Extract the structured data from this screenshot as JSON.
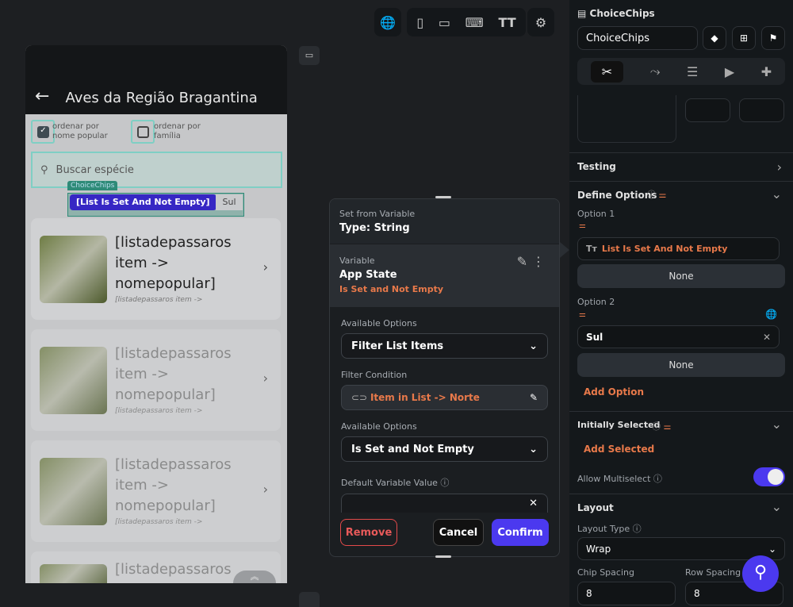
{
  "toolbar": {
    "icons": [
      "globe-icon",
      "phone-icon",
      "tablet-icon",
      "keyboard-icon",
      "text-size-icon",
      "tree-icon"
    ]
  },
  "phone": {
    "title": "Aves da Região Bragantina",
    "check1": "ordenar por nome popular",
    "check2": "ordenar por família",
    "search_placeholder": "Buscar espécie",
    "chip_tag": "ChoiceChips",
    "chip1": "[List Is Set And Not Empty]",
    "chip2": "Sul",
    "items": [
      {
        "title": "[listadepassaros item -> nomepopular]",
        "sub": "[listadepassaros item ->"
      },
      {
        "title": "[listadepassaros item -> nomepopular]",
        "sub": "[listadepassaros item ->"
      },
      {
        "title": "[listadepassaros item -> nomepopular]",
        "sub": "[listadepassaros item ->"
      },
      {
        "title": "[listadepassaros",
        "sub": ""
      }
    ]
  },
  "popup": {
    "header_label": "Set from Variable",
    "header_type": "Type: String",
    "var_label": "Variable",
    "var_source": "App State",
    "var_cond": "Is Set and Not Empty",
    "opt1_label": "Available Options",
    "opt1_value": "Filter List Items",
    "filter_label": "Filter Condition",
    "filter_value": "Item in List -> Norte",
    "opt2_label": "Available Options",
    "opt2_value": "Is Set and Not Empty",
    "default_label": "Default Variable Value",
    "remove": "Remove",
    "cancel": "Cancel",
    "confirm": "Confirm"
  },
  "panel": {
    "widget_type": "ChoiceChips",
    "widget_name": "ChoiceChips",
    "testing": "Testing",
    "define_options": "Define Options",
    "option1_label": "Option 1",
    "option1_value": "List Is Set And Not Empty",
    "none1": "None",
    "option2_label": "Option 2",
    "option2_value": "Sul",
    "none2": "None",
    "add_option": "Add Option",
    "initially_selected": "Initially Selected",
    "add_selected": "Add Selected",
    "allow_multiselect": "Allow Multiselect",
    "multiselect_on": true,
    "layout": "Layout",
    "layout_type_label": "Layout Type",
    "layout_type": "Wrap",
    "chip_spacing_label": "Chip Spacing",
    "chip_spacing": "8",
    "row_spacing_label": "Row Spacing",
    "row_spacing": "8"
  },
  "colors": {
    "accent": "#4b39ef",
    "orange": "#e8794a",
    "teal": "#39b9a8"
  }
}
